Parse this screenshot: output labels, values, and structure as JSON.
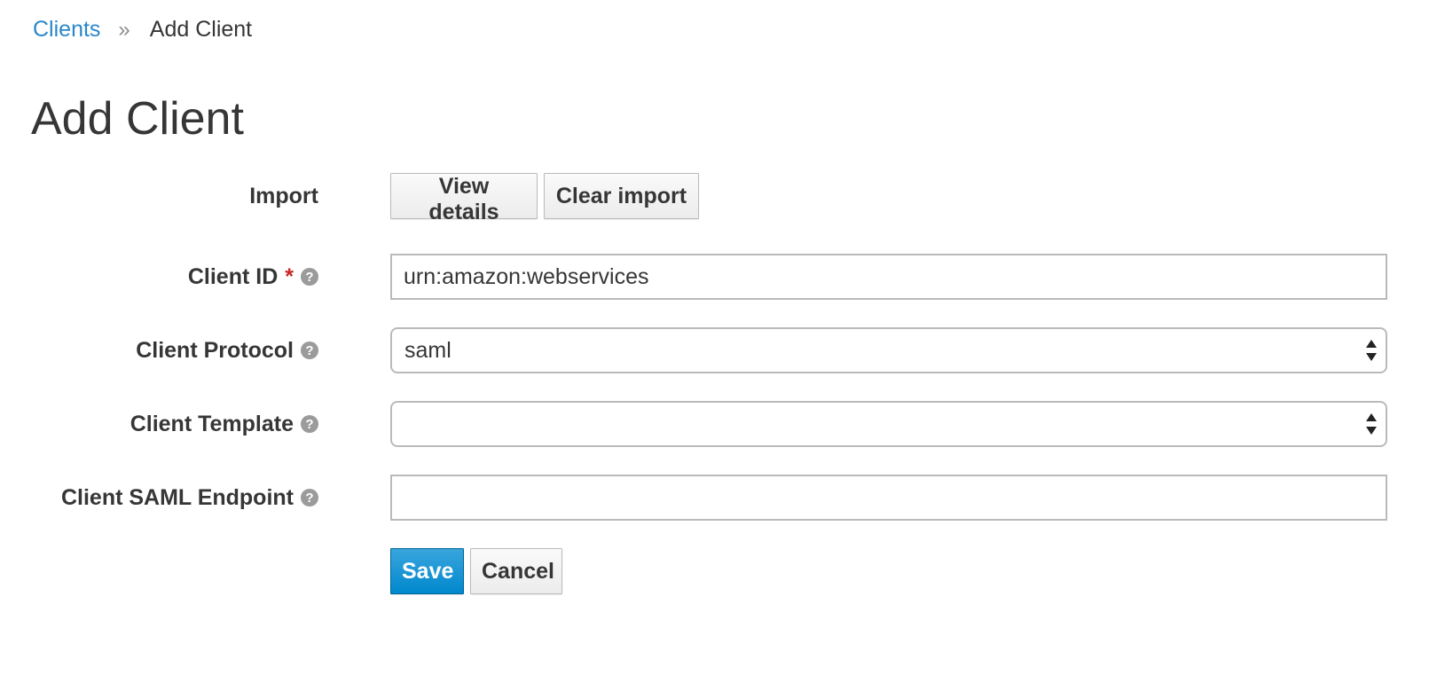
{
  "breadcrumb": {
    "parent_label": "Clients",
    "separator": "»",
    "current_label": "Add Client"
  },
  "page": {
    "title": "Add Client"
  },
  "form": {
    "import": {
      "label": "Import",
      "view_details_label": "View details",
      "clear_import_label": "Clear import"
    },
    "client_id": {
      "label": "Client ID",
      "required_marker": "*",
      "value": "urn:amazon:webservices",
      "help_icon": "question-circle-icon"
    },
    "client_protocol": {
      "label": "Client Protocol",
      "selected": "saml",
      "help_icon": "question-circle-icon"
    },
    "client_template": {
      "label": "Client Template",
      "selected": "",
      "help_icon": "question-circle-icon"
    },
    "client_saml_endpoint": {
      "label": "Client SAML Endpoint",
      "value": "",
      "help_icon": "question-circle-icon"
    },
    "actions": {
      "save_label": "Save",
      "cancel_label": "Cancel"
    }
  },
  "colors": {
    "link": "#2b87c9",
    "required": "#c92525",
    "primary_button": "#0088ce",
    "help_icon": "#9b9b9b",
    "text": "#363636"
  }
}
